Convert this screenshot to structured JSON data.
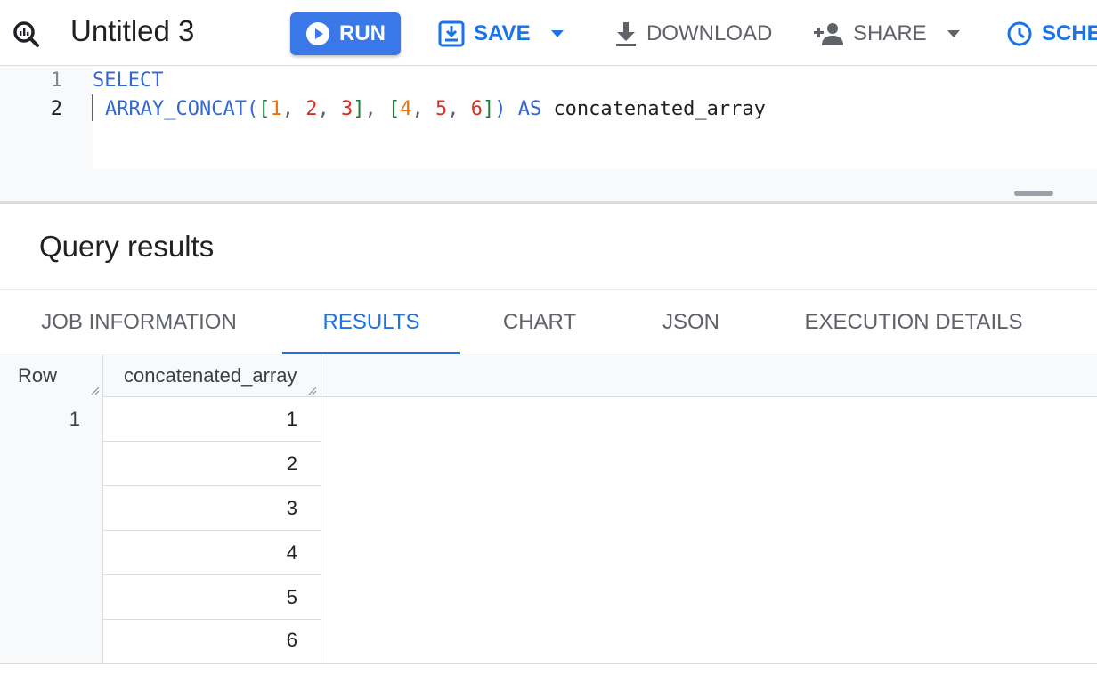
{
  "toolbar": {
    "tab_title": "Untitled 3",
    "run_label": "RUN",
    "save_label": "SAVE",
    "download_label": "DOWNLOAD",
    "share_label": "SHARE",
    "schedule_label": "SCHE"
  },
  "editor": {
    "line_numbers": [
      "1",
      "2"
    ],
    "line1": {
      "keyword": "SELECT"
    },
    "line2": {
      "fn": "ARRAY_CONCAT",
      "open_paren": "(",
      "b1_open": "[",
      "n1": "1",
      "c1": ", ",
      "n2": "2",
      "c2": ", ",
      "n3": "3",
      "b1_close": "]",
      "sep": ", ",
      "b2_open": "[",
      "n4": "4",
      "c4": ", ",
      "n5": "5",
      "c5": ", ",
      "n6": "6",
      "b2_close": "]",
      "close_paren": ")",
      "as_kw": " AS ",
      "alias": "concatenated_array"
    }
  },
  "results": {
    "title": "Query results",
    "tabs": [
      {
        "label": "JOB INFORMATION",
        "active": false
      },
      {
        "label": "RESULTS",
        "active": true
      },
      {
        "label": "CHART",
        "active": false
      },
      {
        "label": "JSON",
        "active": false
      },
      {
        "label": "EXECUTION DETAILS",
        "active": false
      }
    ],
    "table": {
      "headers": [
        "Row",
        "concatenated_array"
      ],
      "row_number": "1",
      "values": [
        "1",
        "2",
        "3",
        "4",
        "5",
        "6"
      ]
    }
  },
  "colors": {
    "primary": "#1a73e8",
    "run_button": "#3b78e7"
  },
  "icons": {
    "logo": "bigquery-magnifier-icon",
    "run": "play-circle-icon",
    "save": "save-icon",
    "download": "download-icon",
    "share": "person-add-icon",
    "schedule": "clock-icon"
  }
}
